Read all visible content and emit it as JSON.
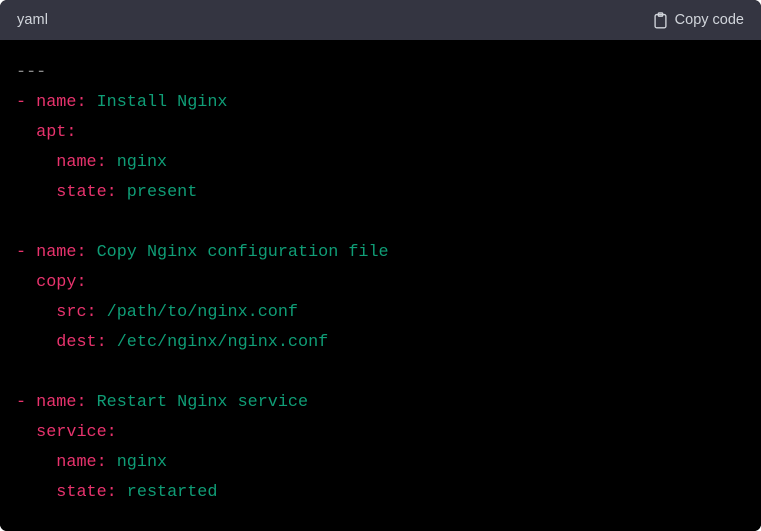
{
  "header": {
    "language_label": "yaml",
    "copy_label": "Copy code",
    "copy_icon": "clipboard-icon",
    "background_color": "#343541",
    "text_color": "#d1d5db"
  },
  "code": {
    "language": "yaml",
    "background_color": "#000000",
    "colors": {
      "document_marker": "#8b8b8b",
      "key": "#e8336d",
      "value": "#0f9d76",
      "plain": "#c8c8c8"
    },
    "raw_text": "---\n- name: Install Nginx\n  apt:\n    name: nginx\n    state: present\n\n- name: Copy Nginx configuration file\n  copy:\n    src: /path/to/nginx.conf\n    dest: /etc/nginx/nginx.conf\n\n- name: Restart Nginx service\n  service:\n    name: nginx\n    state: restarted",
    "lines": [
      {
        "tokens": [
          {
            "text": "---",
            "type": "meta"
          }
        ]
      },
      {
        "tokens": [
          {
            "text": "- ",
            "type": "punct"
          },
          {
            "text": "name:",
            "type": "key"
          },
          {
            "text": " Install Nginx",
            "type": "val"
          }
        ]
      },
      {
        "tokens": [
          {
            "text": "  ",
            "type": "plain"
          },
          {
            "text": "apt:",
            "type": "key"
          }
        ]
      },
      {
        "tokens": [
          {
            "text": "    ",
            "type": "plain"
          },
          {
            "text": "name:",
            "type": "key"
          },
          {
            "text": " nginx",
            "type": "val"
          }
        ]
      },
      {
        "tokens": [
          {
            "text": "    ",
            "type": "plain"
          },
          {
            "text": "state:",
            "type": "key"
          },
          {
            "text": " present",
            "type": "val"
          }
        ]
      },
      {
        "tokens": []
      },
      {
        "tokens": [
          {
            "text": "- ",
            "type": "punct"
          },
          {
            "text": "name:",
            "type": "key"
          },
          {
            "text": " Copy Nginx configuration file",
            "type": "val"
          }
        ]
      },
      {
        "tokens": [
          {
            "text": "  ",
            "type": "plain"
          },
          {
            "text": "copy:",
            "type": "key"
          }
        ]
      },
      {
        "tokens": [
          {
            "text": "    ",
            "type": "plain"
          },
          {
            "text": "src:",
            "type": "key"
          },
          {
            "text": " /path/to/nginx.conf",
            "type": "val"
          }
        ]
      },
      {
        "tokens": [
          {
            "text": "    ",
            "type": "plain"
          },
          {
            "text": "dest:",
            "type": "key"
          },
          {
            "text": " /etc/nginx/nginx.conf",
            "type": "val"
          }
        ]
      },
      {
        "tokens": []
      },
      {
        "tokens": [
          {
            "text": "- ",
            "type": "punct"
          },
          {
            "text": "name:",
            "type": "key"
          },
          {
            "text": " Restart Nginx service",
            "type": "val"
          }
        ]
      },
      {
        "tokens": [
          {
            "text": "  ",
            "type": "plain"
          },
          {
            "text": "service:",
            "type": "key"
          }
        ]
      },
      {
        "tokens": [
          {
            "text": "    ",
            "type": "plain"
          },
          {
            "text": "name:",
            "type": "key"
          },
          {
            "text": " nginx",
            "type": "val"
          }
        ]
      },
      {
        "tokens": [
          {
            "text": "    ",
            "type": "plain"
          },
          {
            "text": "state:",
            "type": "key"
          },
          {
            "text": " restarted",
            "type": "val"
          }
        ]
      }
    ]
  }
}
